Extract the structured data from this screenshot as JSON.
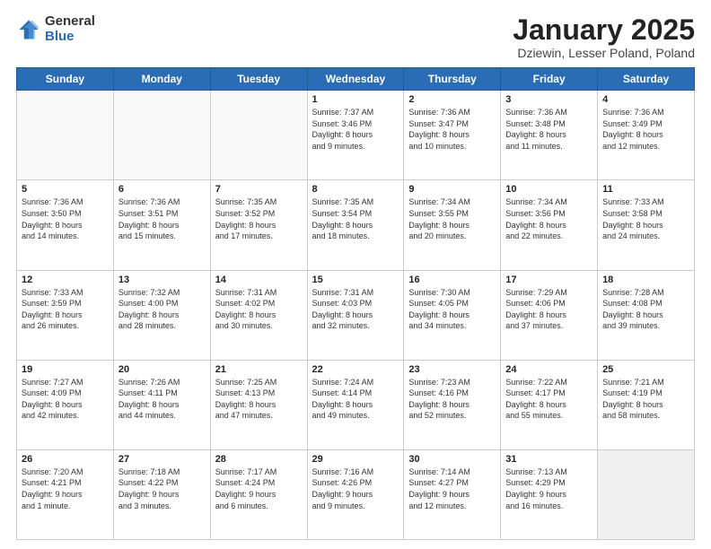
{
  "header": {
    "logo_general": "General",
    "logo_blue": "Blue",
    "title": "January 2025",
    "location": "Dziewin, Lesser Poland, Poland"
  },
  "weekdays": [
    "Sunday",
    "Monday",
    "Tuesday",
    "Wednesday",
    "Thursday",
    "Friday",
    "Saturday"
  ],
  "weeks": [
    [
      {
        "day": "",
        "info": "",
        "empty": true
      },
      {
        "day": "",
        "info": "",
        "empty": true
      },
      {
        "day": "",
        "info": "",
        "empty": true
      },
      {
        "day": "1",
        "info": "Sunrise: 7:37 AM\nSunset: 3:46 PM\nDaylight: 8 hours\nand 9 minutes."
      },
      {
        "day": "2",
        "info": "Sunrise: 7:36 AM\nSunset: 3:47 PM\nDaylight: 8 hours\nand 10 minutes."
      },
      {
        "day": "3",
        "info": "Sunrise: 7:36 AM\nSunset: 3:48 PM\nDaylight: 8 hours\nand 11 minutes."
      },
      {
        "day": "4",
        "info": "Sunrise: 7:36 AM\nSunset: 3:49 PM\nDaylight: 8 hours\nand 12 minutes."
      }
    ],
    [
      {
        "day": "5",
        "info": "Sunrise: 7:36 AM\nSunset: 3:50 PM\nDaylight: 8 hours\nand 14 minutes."
      },
      {
        "day": "6",
        "info": "Sunrise: 7:36 AM\nSunset: 3:51 PM\nDaylight: 8 hours\nand 15 minutes."
      },
      {
        "day": "7",
        "info": "Sunrise: 7:35 AM\nSunset: 3:52 PM\nDaylight: 8 hours\nand 17 minutes."
      },
      {
        "day": "8",
        "info": "Sunrise: 7:35 AM\nSunset: 3:54 PM\nDaylight: 8 hours\nand 18 minutes."
      },
      {
        "day": "9",
        "info": "Sunrise: 7:34 AM\nSunset: 3:55 PM\nDaylight: 8 hours\nand 20 minutes."
      },
      {
        "day": "10",
        "info": "Sunrise: 7:34 AM\nSunset: 3:56 PM\nDaylight: 8 hours\nand 22 minutes."
      },
      {
        "day": "11",
        "info": "Sunrise: 7:33 AM\nSunset: 3:58 PM\nDaylight: 8 hours\nand 24 minutes."
      }
    ],
    [
      {
        "day": "12",
        "info": "Sunrise: 7:33 AM\nSunset: 3:59 PM\nDaylight: 8 hours\nand 26 minutes."
      },
      {
        "day": "13",
        "info": "Sunrise: 7:32 AM\nSunset: 4:00 PM\nDaylight: 8 hours\nand 28 minutes."
      },
      {
        "day": "14",
        "info": "Sunrise: 7:31 AM\nSunset: 4:02 PM\nDaylight: 8 hours\nand 30 minutes."
      },
      {
        "day": "15",
        "info": "Sunrise: 7:31 AM\nSunset: 4:03 PM\nDaylight: 8 hours\nand 32 minutes."
      },
      {
        "day": "16",
        "info": "Sunrise: 7:30 AM\nSunset: 4:05 PM\nDaylight: 8 hours\nand 34 minutes."
      },
      {
        "day": "17",
        "info": "Sunrise: 7:29 AM\nSunset: 4:06 PM\nDaylight: 8 hours\nand 37 minutes."
      },
      {
        "day": "18",
        "info": "Sunrise: 7:28 AM\nSunset: 4:08 PM\nDaylight: 8 hours\nand 39 minutes."
      }
    ],
    [
      {
        "day": "19",
        "info": "Sunrise: 7:27 AM\nSunset: 4:09 PM\nDaylight: 8 hours\nand 42 minutes."
      },
      {
        "day": "20",
        "info": "Sunrise: 7:26 AM\nSunset: 4:11 PM\nDaylight: 8 hours\nand 44 minutes."
      },
      {
        "day": "21",
        "info": "Sunrise: 7:25 AM\nSunset: 4:13 PM\nDaylight: 8 hours\nand 47 minutes."
      },
      {
        "day": "22",
        "info": "Sunrise: 7:24 AM\nSunset: 4:14 PM\nDaylight: 8 hours\nand 49 minutes."
      },
      {
        "day": "23",
        "info": "Sunrise: 7:23 AM\nSunset: 4:16 PM\nDaylight: 8 hours\nand 52 minutes."
      },
      {
        "day": "24",
        "info": "Sunrise: 7:22 AM\nSunset: 4:17 PM\nDaylight: 8 hours\nand 55 minutes."
      },
      {
        "day": "25",
        "info": "Sunrise: 7:21 AM\nSunset: 4:19 PM\nDaylight: 8 hours\nand 58 minutes."
      }
    ],
    [
      {
        "day": "26",
        "info": "Sunrise: 7:20 AM\nSunset: 4:21 PM\nDaylight: 9 hours\nand 1 minute."
      },
      {
        "day": "27",
        "info": "Sunrise: 7:18 AM\nSunset: 4:22 PM\nDaylight: 9 hours\nand 3 minutes."
      },
      {
        "day": "28",
        "info": "Sunrise: 7:17 AM\nSunset: 4:24 PM\nDaylight: 9 hours\nand 6 minutes."
      },
      {
        "day": "29",
        "info": "Sunrise: 7:16 AM\nSunset: 4:26 PM\nDaylight: 9 hours\nand 9 minutes."
      },
      {
        "day": "30",
        "info": "Sunrise: 7:14 AM\nSunset: 4:27 PM\nDaylight: 9 hours\nand 12 minutes."
      },
      {
        "day": "31",
        "info": "Sunrise: 7:13 AM\nSunset: 4:29 PM\nDaylight: 9 hours\nand 16 minutes."
      },
      {
        "day": "",
        "info": "",
        "empty": true
      }
    ]
  ]
}
